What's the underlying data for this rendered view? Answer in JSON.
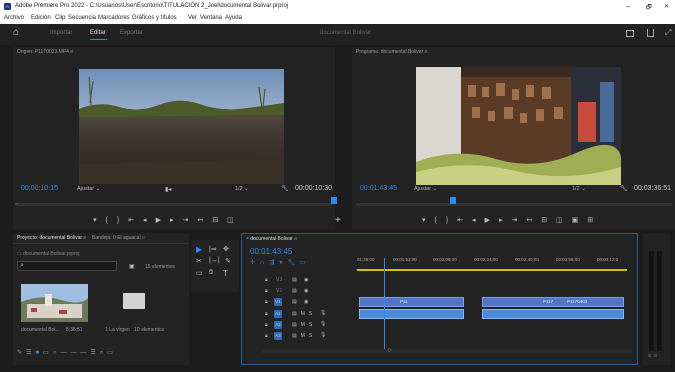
{
  "window": {
    "title": "Adobe Premiere Pro 2022 - C:\\Usuarios\\User\\Escritorio\\TITULACIÓN 2_Joel\\documental Bolivar.prproj",
    "app_icon_text": "Pr",
    "minimize": "–",
    "maximize": "🗗",
    "close": "✕"
  },
  "menu": [
    "Archivo",
    "Edición",
    "Clip",
    "Secuencia",
    "Marcadores",
    "Gráficos y títulos",
    "Ver",
    "Ventana",
    "Ayuda"
  ],
  "workspaces": {
    "home": "⌂",
    "tabs": [
      "Importar",
      "Editar",
      "Exportar"
    ],
    "active": "Editar",
    "title": "documental Bolivar"
  },
  "source": {
    "title": "Origen: P1170023.MP4",
    "timecode": "00:00:10:15",
    "fit": "Ajustar",
    "resolution": "1/2",
    "duration": "00:00:10:30"
  },
  "program": {
    "title": "Programa: documental Bolivar",
    "timecode": "00:01:43:45",
    "fit": "Ajustar",
    "resolution": "1/2",
    "duration": "00:03:36:51"
  },
  "project": {
    "tabs": [
      "Proyecto: documental Bolivar",
      "Bandeja: 0 El aguacal"
    ],
    "file": "documental Bolivar.prproj",
    "count": "15 elementos",
    "items": [
      {
        "name": "documental Bol...",
        "duration": "5;36:51"
      },
      {
        "name": "1 La virgen",
        "duration": "10 elementos"
      }
    ]
  },
  "timeline": {
    "tab": "documental Bolivar",
    "timecode": "00:01:43:45",
    "ruler": [
      "01:36:00",
      "00:01:52:00",
      "00:02:08:00",
      "00:02:24:00",
      "00:02:40:00",
      "00:02:56:00",
      "00:03:12:0"
    ],
    "tracks": [
      "V3",
      "V2",
      "V1",
      "A1",
      "A2",
      "A3"
    ],
    "clip_labels": [
      "P11",
      "P117",
      "P1170403"
    ]
  },
  "colors": {
    "accent": "#2d8ceb",
    "video_clip": "#4f75c8",
    "audio_clip": "#4d8bd8",
    "playhead": "#2d8ceb",
    "work_area": "#d6c500"
  }
}
